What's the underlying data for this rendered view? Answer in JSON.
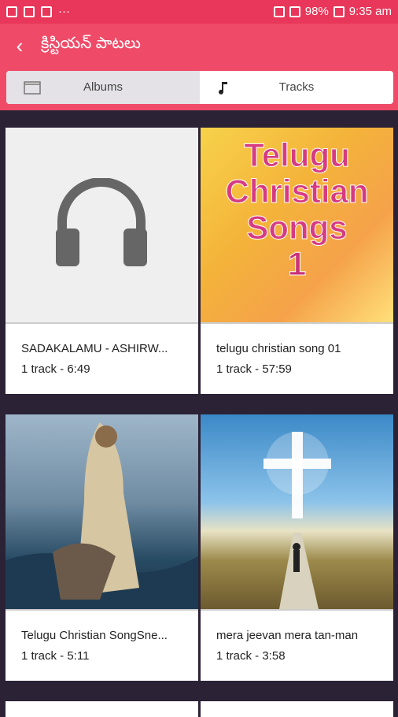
{
  "status": {
    "battery": "98%",
    "time": "9:35 am"
  },
  "appbar": {
    "title": "క్రిస్టియన్ పాటలు",
    "back_label": "‹"
  },
  "tabs": [
    {
      "label": "Albums",
      "icon": "album-icon"
    },
    {
      "label": "Tracks",
      "icon": "music-note-icon"
    }
  ],
  "albums": [
    {
      "name": "SADAKALAMU - ASHIRW...",
      "meta": "1 track - 6:49",
      "cover": "headphones-icon"
    },
    {
      "name": "telugu christian song 01",
      "meta": "1 track - 57:59",
      "cover": "text-cover",
      "cover_lines": [
        "Telugu",
        "Christian",
        "Songs",
        "1"
      ]
    },
    {
      "name": "Telugu Christian SongSne...",
      "meta": "1 track - 5:11",
      "cover": "painting"
    },
    {
      "name": "mera jeevan mera tan-man",
      "meta": "1 track - 3:58",
      "cover": "cross-road"
    }
  ],
  "colors": {
    "accent": "#ef4b68",
    "background": "#2b2236"
  }
}
